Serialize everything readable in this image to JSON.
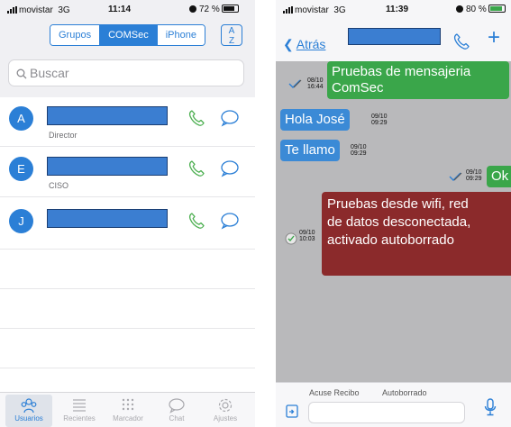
{
  "left_screen": {
    "status": {
      "carrier": "movistar",
      "network": "3G",
      "time": "11:14",
      "battery": "72 %",
      "battery_level": 0.72
    },
    "segments": [
      {
        "label": "Grupos",
        "active": false
      },
      {
        "label": "COMSec",
        "active": true
      },
      {
        "label": "iPhone",
        "active": false
      }
    ],
    "sort_icon": "sort-az-icon",
    "search": {
      "placeholder": "Buscar"
    },
    "contacts": [
      {
        "initial": "A",
        "subtitle": "Director"
      },
      {
        "initial": "E",
        "subtitle": "CISO"
      },
      {
        "initial": "J",
        "subtitle": ""
      }
    ],
    "tabs": [
      {
        "label": "Usuarios",
        "icon": "users-icon",
        "active": true
      },
      {
        "label": "Recientes",
        "icon": "list-icon",
        "active": false
      },
      {
        "label": "Marcador",
        "icon": "keypad-icon",
        "active": false
      },
      {
        "label": "Chat",
        "icon": "chat-icon",
        "active": false
      },
      {
        "label": "Ajustes",
        "icon": "gear-icon",
        "active": false
      }
    ]
  },
  "right_screen": {
    "status": {
      "carrier": "movistar",
      "network": "3G",
      "time": "11:39",
      "battery": "80 %",
      "battery_level": 0.8
    },
    "nav": {
      "back_label": "Atrás"
    },
    "messages": [
      {
        "text_lines": [
          "Pruebas de mensajeria",
          "ComSec"
        ],
        "date": "08/10",
        "time": "16:44",
        "direction": "sent",
        "color": "#3aa64a"
      },
      {
        "text_lines": [
          "Hola José"
        ],
        "date": "09/10",
        "time": "09:29",
        "direction": "received",
        "color": "#3b8ad6"
      },
      {
        "text_lines": [
          "Te llamo"
        ],
        "date": "09/10",
        "time": "09:29",
        "direction": "received",
        "color": "#3b8ad6"
      },
      {
        "text_lines": [
          "Ok"
        ],
        "date": "09/10",
        "time": "09:29",
        "direction": "sent",
        "color": "#3aa64a"
      },
      {
        "text_lines": [
          "Pruebas desde wifi, red",
          "de datos desconectada,",
          "activado autoborrado"
        ],
        "date": "09/10",
        "time": "10:03",
        "direction": "sent",
        "color": "#8b2a2b"
      }
    ],
    "composer": {
      "option1": "Acuse Recibo",
      "option2": "Autoborrado"
    }
  },
  "colors": {
    "accent": "#2b7fd6",
    "redaction": "#3b7ed1"
  }
}
